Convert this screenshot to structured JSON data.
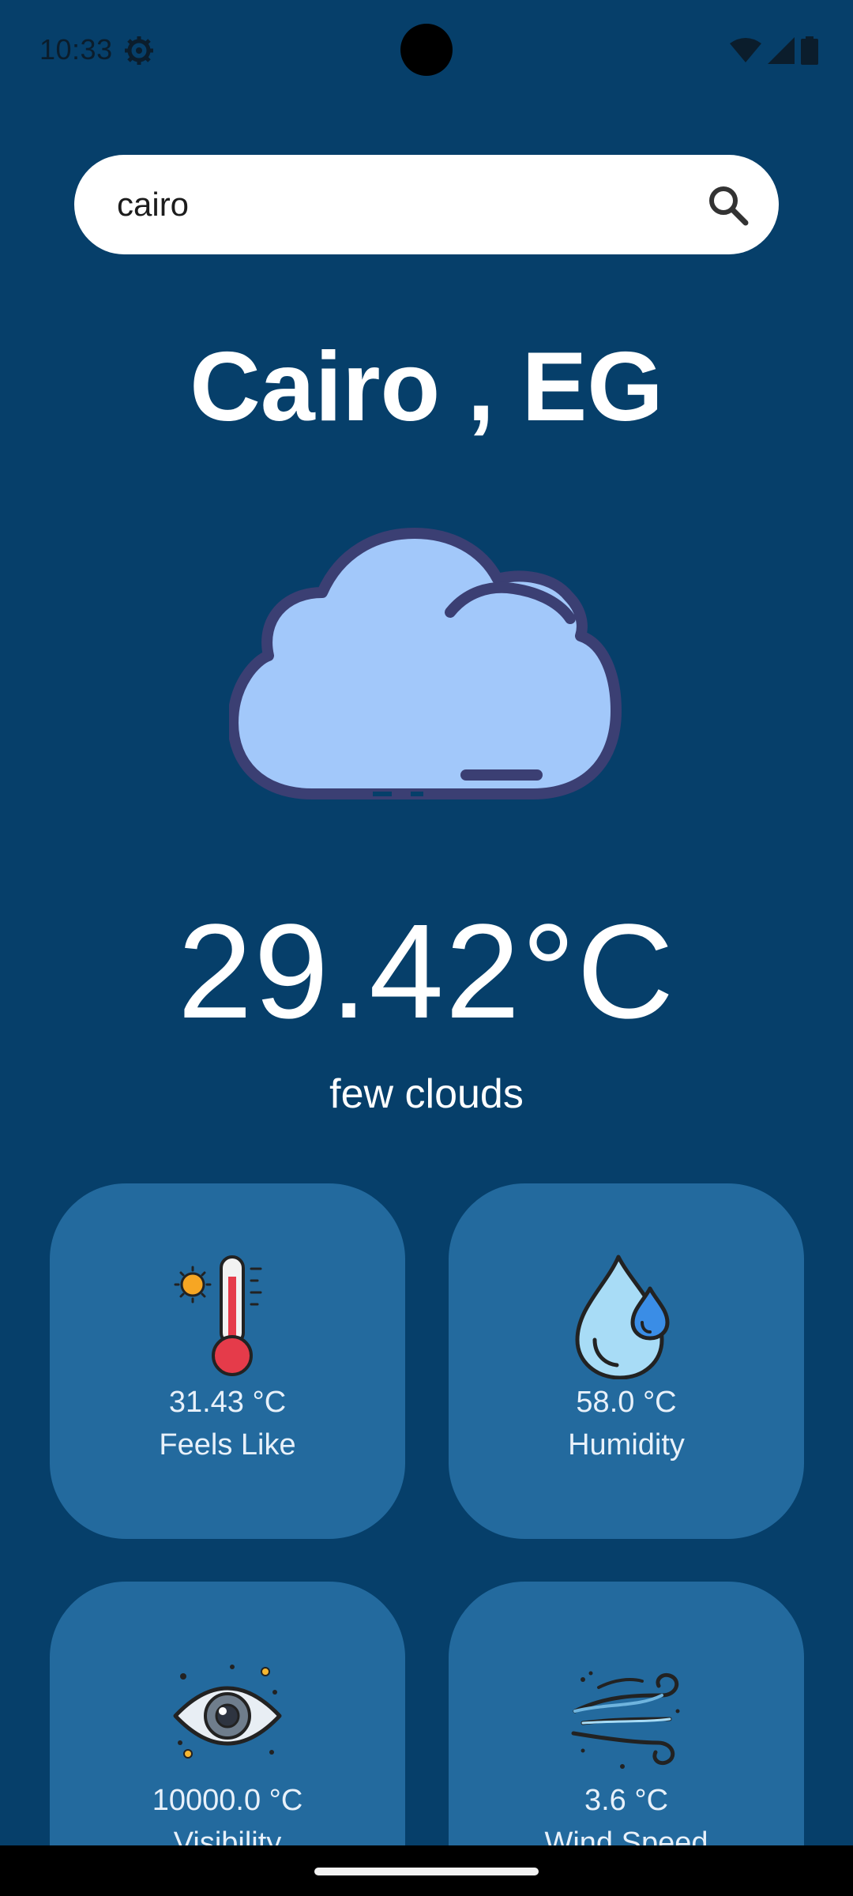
{
  "status_bar": {
    "time": "10:33"
  },
  "search": {
    "value": "cairo",
    "placeholder": ""
  },
  "location": {
    "title": "Cairo , EG"
  },
  "current": {
    "temperature": "29.42°C",
    "description": "few clouds",
    "icon": "cloud-icon"
  },
  "cards": [
    {
      "value": "31.43 °C",
      "label": "Feels Like",
      "icon": "thermometer-icon"
    },
    {
      "value": "58.0 °C",
      "label": "Humidity",
      "icon": "water-drops-icon"
    },
    {
      "value": "10000.0 °C",
      "label": "Visibility",
      "icon": "eye-icon"
    },
    {
      "value": "3.6 °C",
      "label": "Wind Speed",
      "icon": "wind-icon"
    }
  ],
  "colors": {
    "background": "#063f6a",
    "card": "#236a9e",
    "cloud_fill": "#a2c8fa",
    "cloud_outline": "#3b3f73"
  }
}
